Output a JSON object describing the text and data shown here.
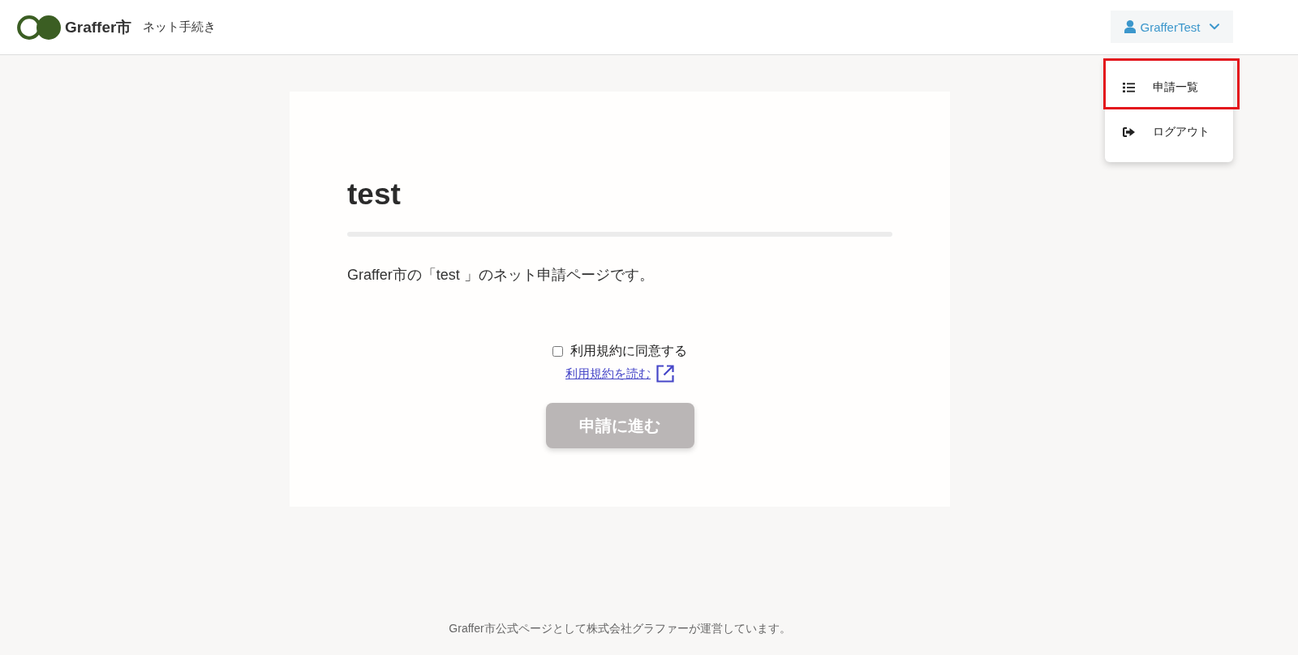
{
  "header": {
    "logo_text": "Graffer市",
    "service_name": "ネット手続き",
    "user_menu": {
      "label": "GrafferTest",
      "expanded": true,
      "items": [
        {
          "label": "申請一覧",
          "kind": "list",
          "highlighted": true
        },
        {
          "label": "ログアウト",
          "kind": "logout",
          "highlighted": false
        }
      ]
    }
  },
  "card": {
    "title": "test",
    "description": "Graffer市の「test 」のネット申請ページです。",
    "agreement": {
      "label": "利用規約に同意する",
      "checked": false
    },
    "terms_link": "利用規約を読む",
    "submit_button": {
      "label": "申請に進む",
      "disabled": true
    }
  },
  "footer": {
    "text": "Graffer市公式ページとして株式会社グラファーが運営しています。"
  }
}
